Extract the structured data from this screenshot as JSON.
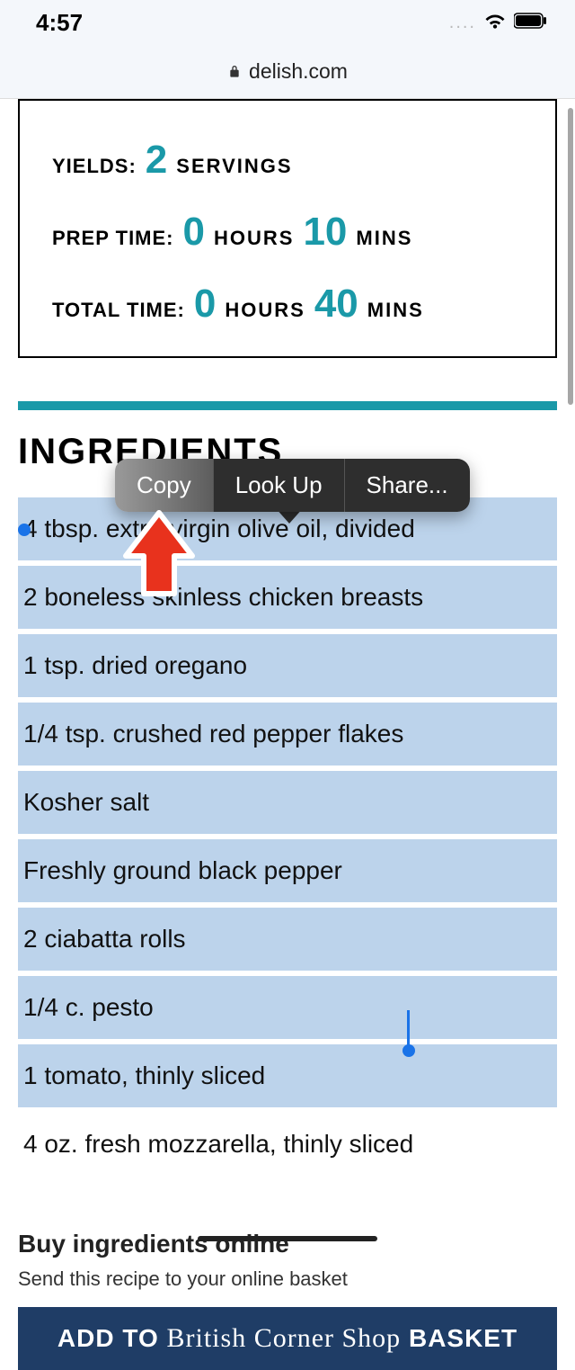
{
  "status": {
    "time": "4:57"
  },
  "url": "delish.com",
  "recipe": {
    "yields_label": "YIELDS:",
    "yields_value": "2",
    "yields_unit": "SERVINGS",
    "prep_label": "PREP TIME:",
    "prep_hours": "0",
    "prep_hours_unit": "HOURS",
    "prep_mins": "10",
    "prep_mins_unit": "MINS",
    "total_label": "TOTAL TIME:",
    "total_hours": "0",
    "total_hours_unit": "HOURS",
    "total_mins": "40",
    "total_mins_unit": "MINS"
  },
  "section_title": "INGREDIENTS",
  "ingredients": [
    "4 tbsp. extra-virgin olive oil, divided",
    "2 boneless skinless chicken breasts",
    "1 tsp. dried oregano",
    "1/4 tsp. crushed red pepper flakes",
    "Kosher salt",
    "Freshly ground black pepper",
    "2 ciabatta rolls",
    "1/4 c. pesto",
    "1 tomato, thinly sliced",
    "4 oz. fresh mozzarella, thinly sliced"
  ],
  "context_menu": {
    "copy": "Copy",
    "lookup": "Look Up",
    "share": "Share..."
  },
  "buy": {
    "title": "Buy ingredients online",
    "subtitle": "Send this recipe to your online basket",
    "btn_prefix": "ADD TO ",
    "btn_brand": "British Corner Shop",
    "btn_suffix": " BASKET"
  }
}
